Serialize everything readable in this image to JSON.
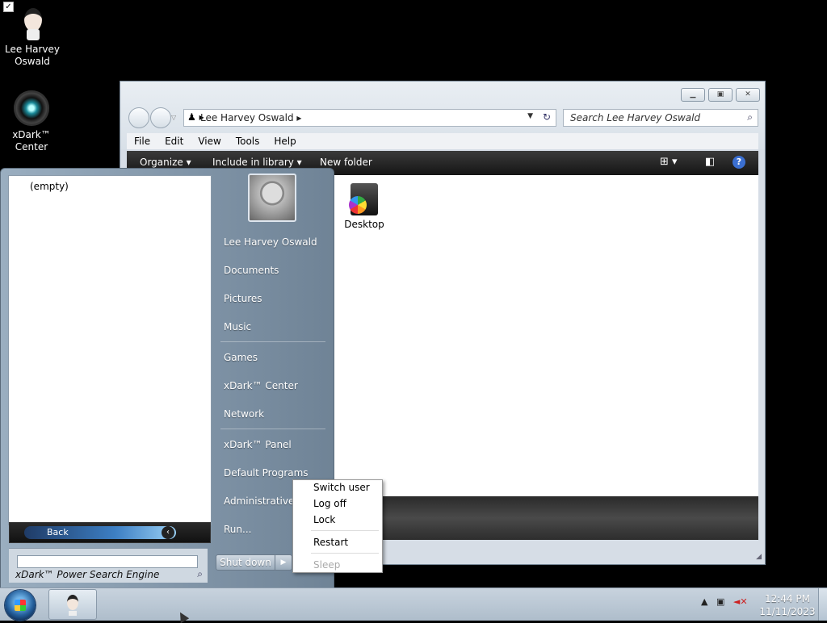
{
  "desktop": {
    "icons": [
      {
        "label": "Lee Harvey Oswald",
        "icon": "user-folder-icon",
        "checked": true
      },
      {
        "label": "xDark™ Center",
        "icon": "xdark-center-icon"
      }
    ]
  },
  "explorer": {
    "breadcrumb": "Lee Harvey Oswald",
    "search_placeholder": "Search Lee Harvey Oswald",
    "menu": [
      "File",
      "Edit",
      "View",
      "Tools",
      "Help"
    ],
    "commands": {
      "organize": "Organize",
      "include": "Include in library",
      "new_folder": "New folder"
    },
    "items": [
      {
        "label": "Desktop",
        "icon": "desktop-folder-icon"
      }
    ]
  },
  "start_menu": {
    "empty_label": "(empty)",
    "back_label": "Back",
    "search_placeholder": "xDark™ Power Search Engine",
    "right_items": [
      "Lee Harvey Oswald",
      "Documents",
      "Pictures",
      "Music",
      "Games",
      "xDark™ Center",
      "Network",
      "xDark™ Panel",
      "Default Programs",
      "Administrative T",
      "Run..."
    ],
    "shutdown_label": "Shut down"
  },
  "power_menu": {
    "items": [
      "Switch user",
      "Log off",
      "Lock",
      "Restart",
      "Sleep"
    ],
    "disabled": [
      "Sleep"
    ]
  },
  "taskbar": {
    "time": "12:44 PM",
    "date": "11/11/2023"
  }
}
